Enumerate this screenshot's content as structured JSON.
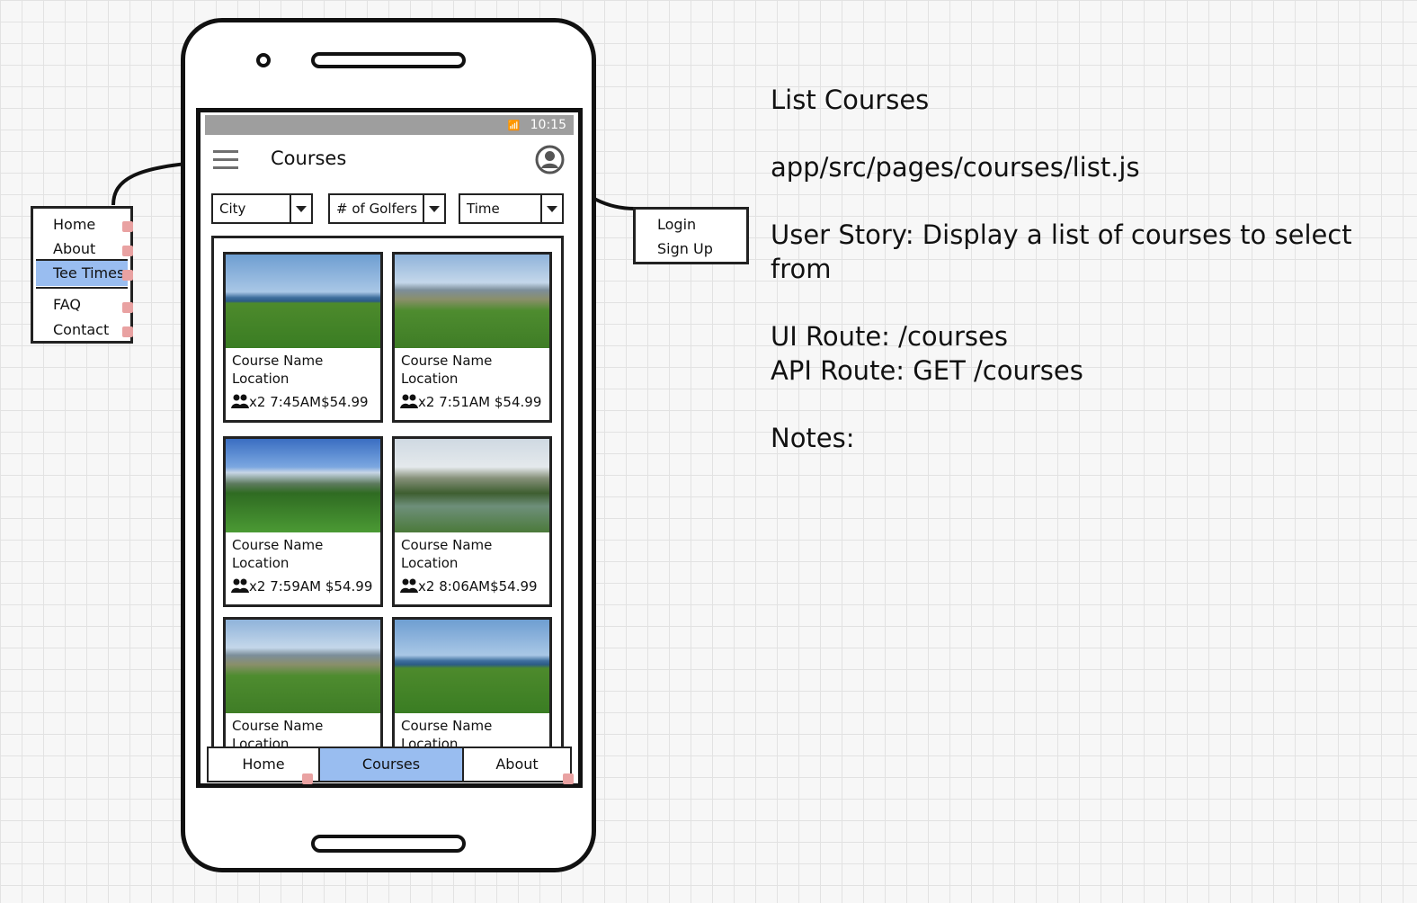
{
  "status_bar": {
    "signal": "📶",
    "time": "10:15"
  },
  "app_bar": {
    "title": "Courses"
  },
  "filters": [
    {
      "label": "City"
    },
    {
      "label": "# of Golfers"
    },
    {
      "label": "Time"
    }
  ],
  "courses": [
    {
      "name": "Course Name",
      "location": "Location",
      "players": "x2",
      "time": "7:45AM",
      "price": "$54.99"
    },
    {
      "name": "Course Name",
      "location": "Location",
      "players": "x2",
      "time": "7:51AM",
      "price": "$54.99"
    },
    {
      "name": "Course Name",
      "location": "Location",
      "players": "x2",
      "time": "7:59AM",
      "price": "$54.99"
    },
    {
      "name": "Course Name",
      "location": "Location",
      "players": "x2",
      "time": "8:06AM",
      "price": "$54.99"
    },
    {
      "name": "Course Name",
      "location": "Location"
    },
    {
      "name": "Course Name",
      "location": "Location"
    }
  ],
  "tab_bar": {
    "tabs": [
      "Home",
      "Courses",
      "About"
    ],
    "active": "Courses"
  },
  "side_menu": {
    "items": [
      "Home",
      "About",
      "Tee Times",
      "FAQ",
      "Contact"
    ],
    "selected": "Tee Times"
  },
  "account_menu": {
    "items": [
      "Login",
      "Sign Up"
    ]
  },
  "notes": {
    "title": "List Courses",
    "file": "app/src/pages/courses/list.js",
    "user_story": "User Story: Display a list of courses to select from",
    "ui_route": "UI Route: /courses",
    "api_route": "API Route: GET /courses",
    "notes_label": "Notes:"
  },
  "colors": {
    "accent": "#99bdf0",
    "status_bar": "#9e9e9e",
    "link_marker": "#e9a2a2"
  }
}
